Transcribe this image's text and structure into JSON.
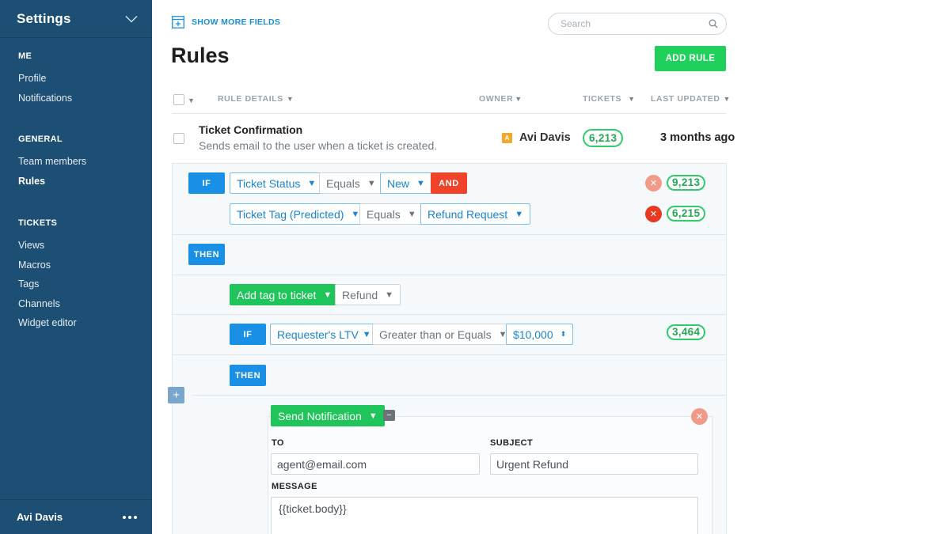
{
  "sidebar": {
    "title": "Settings",
    "sections": [
      {
        "title": "ME",
        "items": [
          {
            "label": "Profile"
          },
          {
            "label": "Notifications"
          }
        ]
      },
      {
        "title": "GENERAL",
        "items": [
          {
            "label": "Team members"
          },
          {
            "label": "Rules",
            "active": true
          }
        ]
      },
      {
        "title": "TICKETS",
        "items": [
          {
            "label": "Views"
          },
          {
            "label": "Macros"
          },
          {
            "label": "Tags"
          },
          {
            "label": "Channels"
          },
          {
            "label": "Widget editor"
          }
        ]
      }
    ],
    "user": "Avi Davis"
  },
  "toolbar": {
    "show_more_label": "SHOW MORE FIELDS"
  },
  "search": {
    "placeholder": "Search"
  },
  "page": {
    "title": "Rules",
    "add_button": "ADD RULE"
  },
  "table": {
    "columns": {
      "details": "RULE DETAILS",
      "owner": "OWNER",
      "tickets": "TICKETS",
      "updated": "LAST UPDATED"
    },
    "row": {
      "name": "Ticket Confirmation",
      "description": "Sends email to the user when a ticket is created.",
      "owner_initial": "A",
      "owner": "Avi Davis",
      "tickets": "6,213",
      "updated": "3 months ago"
    }
  },
  "editor": {
    "if_label": "IF",
    "then_label": "THEN",
    "and_label": "AND",
    "condition1": {
      "field": "Ticket Status",
      "operator": "Equals",
      "value": "New",
      "count": "9,213"
    },
    "condition2": {
      "field": "Ticket Tag (Predicted)",
      "operator": "Equals",
      "value": "Refund Request",
      "count": "6,215"
    },
    "action1": {
      "action": "Add tag to ticket",
      "value": "Refund"
    },
    "condition3": {
      "field": "Requester's LTV",
      "operator": "Greater than or Equals",
      "value": "$10,000",
      "count": "3,464"
    },
    "action2": {
      "action": "Send Notification",
      "to_label": "TO",
      "to_value": "agent@email.com",
      "subject_label": "SUBJECT",
      "subject_value": "Urgent Refund",
      "message_label": "MESSAGE",
      "message_value": "{{ticket.body}}"
    }
  },
  "colors": {
    "sidebar": "#1d4e73",
    "accent_green": "#1fd15a",
    "accent_blue": "#1a8fe6",
    "accent_red": "#f0432a",
    "owner_badge": "#f4a82a"
  }
}
